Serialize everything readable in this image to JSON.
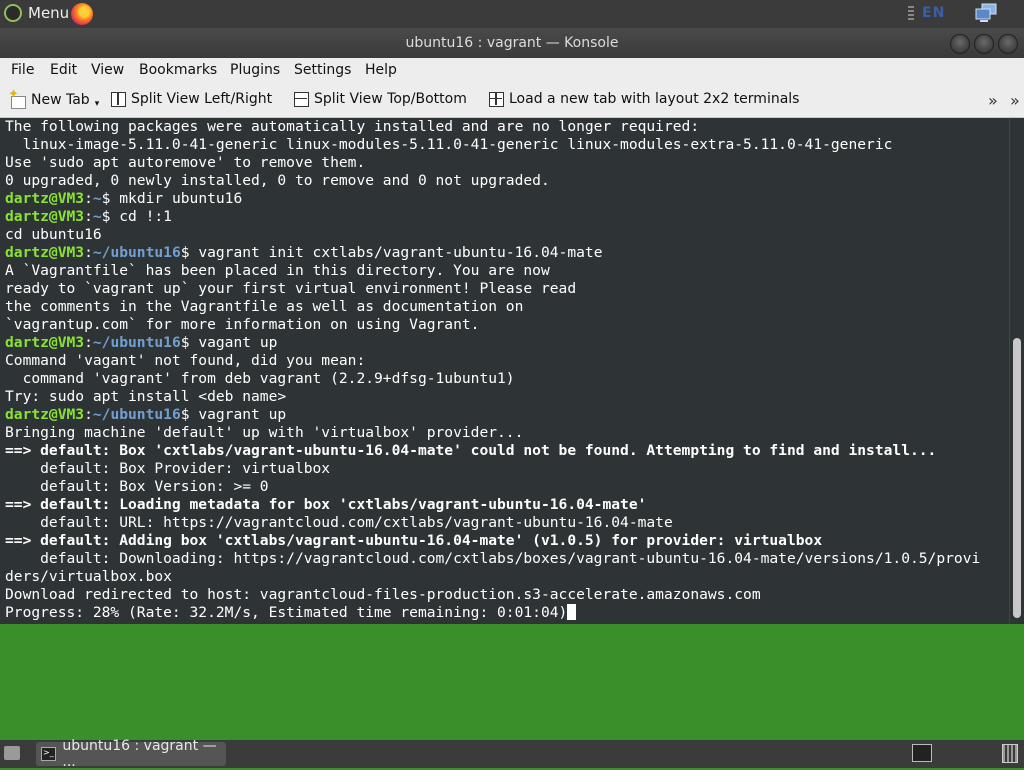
{
  "top_panel": {
    "menu_label": "Menu",
    "language": "EN",
    "menu_icon": "mint-logo-icon",
    "browser_icon": "firefox-icon",
    "network_icon": "network-icon"
  },
  "window": {
    "title": "ubuntu16 : vagrant — Konsole",
    "menu": [
      "File",
      "Edit",
      "View",
      "Bookmarks",
      "Plugins",
      "Settings",
      "Help"
    ],
    "toolbar": {
      "new_tab": "New Tab",
      "split_lr": "Split View Left/Right",
      "split_tb": "Split View Top/Bottom",
      "layout_2x2": "Load a new tab with layout 2x2 terminals",
      "overflow": "»"
    }
  },
  "terminal": {
    "prompt_user": "dartz@VM3",
    "lines": [
      "The following packages were automatically installed and are no longer required:",
      "  linux-image-5.11.0-41-generic linux-modules-5.11.0-41-generic linux-modules-extra-5.11.0-41-generic",
      "Use 'sudo apt autoremove' to remove them.",
      "0 upgraded, 0 newly installed, 0 to remove and 0 not upgraded.",
      "~$ mkdir ubuntu16",
      "~$ cd !:1",
      "cd ubuntu16",
      "~/ubuntu16$ vagrant init cxtlabs/vagrant-ubuntu-16.04-mate",
      "A `Vagrantfile` has been placed in this directory. You are now",
      "ready to `vagrant up` your first virtual environment! Please read",
      "the comments in the Vagrantfile as well as documentation on",
      "`vagrantup.com` for more information on using Vagrant.",
      "~/ubuntu16$ vagant up",
      "Command 'vagant' not found, did you mean:",
      "  command 'vagrant' from deb vagrant (2.2.9+dfsg-1ubuntu1)",
      "Try: sudo apt install <deb name>",
      "~/ubuntu16$ vagrant up",
      "Bringing machine 'default' up with 'virtualbox' provider...",
      "==> default: Box 'cxtlabs/vagrant-ubuntu-16.04-mate' could not be found. Attempting to find and install...",
      "    default: Box Provider: virtualbox",
      "    default: Box Version: >= 0",
      "==> default: Loading metadata for box 'cxtlabs/vagrant-ubuntu-16.04-mate'",
      "    default: URL: https://vagrantcloud.com/cxtlabs/vagrant-ubuntu-16.04-mate",
      "==> default: Adding box 'cxtlabs/vagrant-ubuntu-16.04-mate' (v1.0.5) for provider: virtualbox",
      "    default: Downloading: https://vagrantcloud.com/cxtlabs/boxes/vagrant-ubuntu-16.04-mate/versions/1.0.5/provi",
      "ders/virtualbox.box",
      "Download redirected to host: vagrantcloud-files-production.s3-accelerate.amazonaws.com",
      "Progress: 28% (Rate: 32.2M/s, Estimated time remaining: 0:01:04)"
    ]
  },
  "bottom_panel": {
    "task_label": "ubuntu16 : vagrant — ...",
    "task_icon": "terminal-icon",
    "trash_icon": "trash-icon"
  },
  "colors": {
    "prompt_user": "#8ae234",
    "prompt_path": "#729fcf",
    "terminal_bg": "#2e3436",
    "desktop": "#4aa334"
  }
}
